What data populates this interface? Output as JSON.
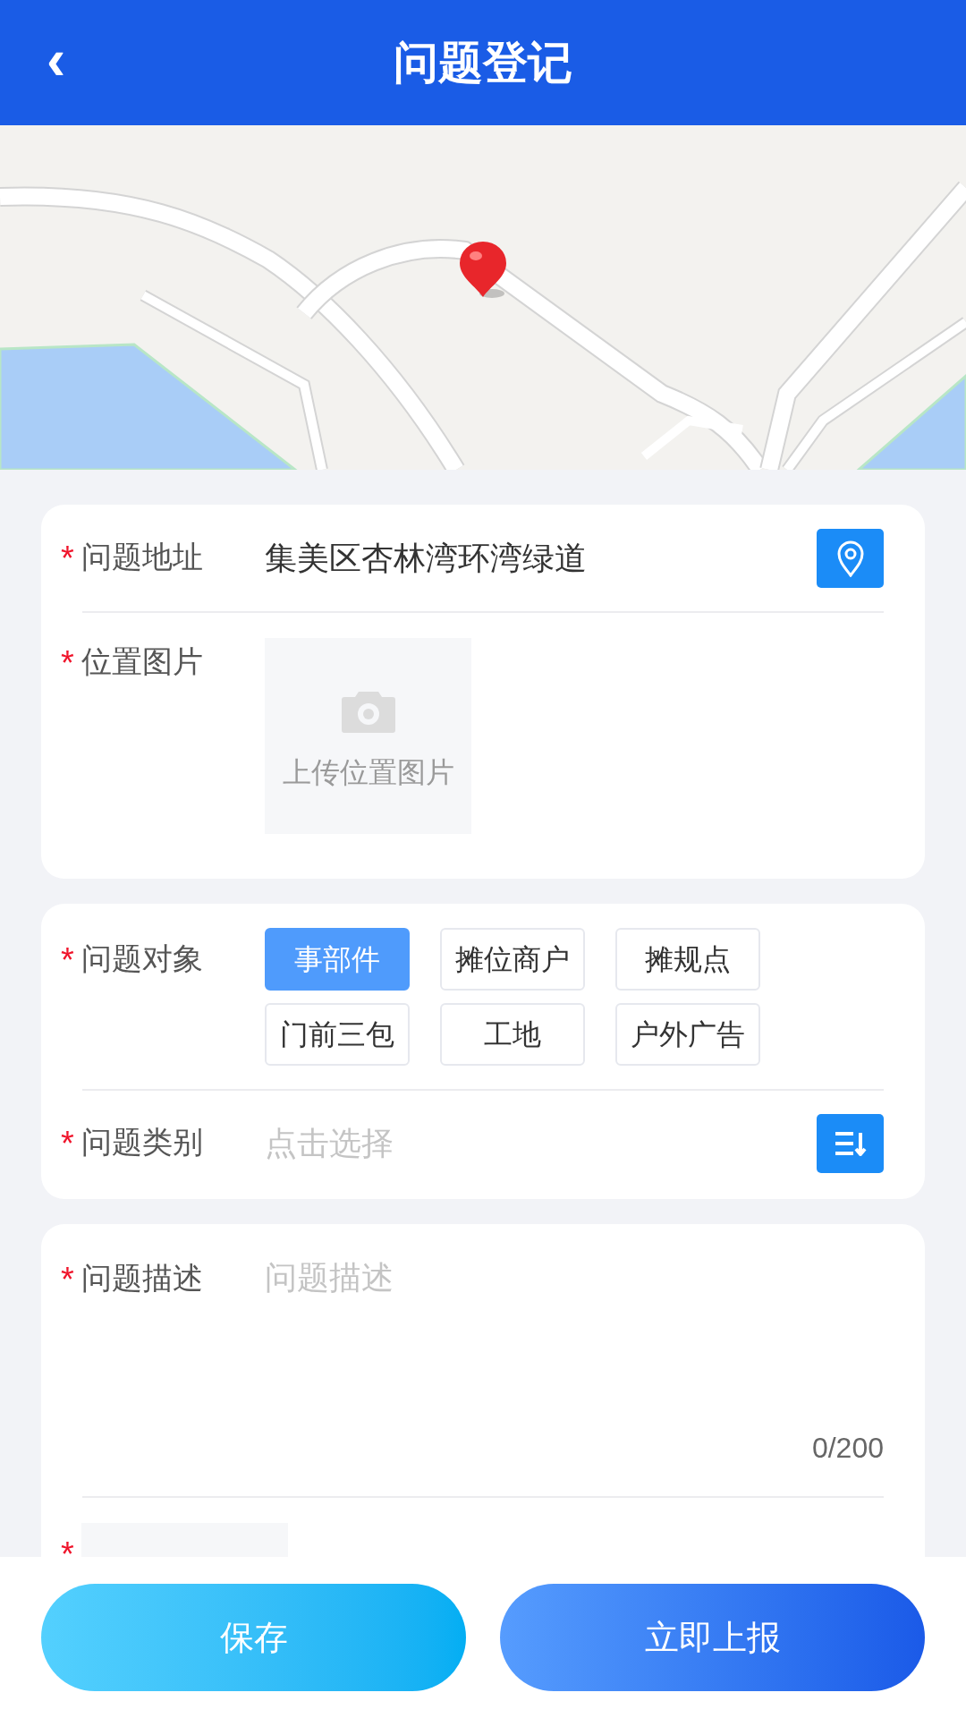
{
  "header": {
    "back_icon": "‹",
    "title": "问题登记"
  },
  "cards": [
    {
      "fields": [
        {
          "kind": "text",
          "mark": "*",
          "label": "问题地址",
          "value": "集美区杏林湾环湾绿道"
        },
        {
          "kind": "upload",
          "mark": "*",
          "label": "位置图片",
          "upload_text": "上传位置图片"
        }
      ]
    },
    {
      "fields": [
        {
          "kind": "chips",
          "mark": "*",
          "label": "问题对象",
          "options": [
            {
              "label": "事部件",
              "selected": true
            },
            {
              "label": "摊位商户",
              "selected": false
            },
            {
              "label": "摊规点",
              "selected": false
            },
            {
              "label": "门前三包",
              "selected": false
            },
            {
              "label": "工地",
              "selected": false
            },
            {
              "label": "户外广告",
              "selected": false
            }
          ]
        },
        {
          "kind": "select",
          "mark": "*",
          "label": "问题类别",
          "placeholder": "点击选择"
        }
      ]
    },
    {
      "fields": [
        {
          "kind": "textarea",
          "mark": "*",
          "label": "问题描述",
          "placeholder": "问题描述",
          "counter": "0/200"
        },
        {
          "kind": "cut",
          "mark": "*"
        }
      ]
    }
  ],
  "buttons": [
    {
      "kind": "save",
      "label": "保存"
    },
    {
      "kind": "submit",
      "label": "立即上报"
    }
  ]
}
